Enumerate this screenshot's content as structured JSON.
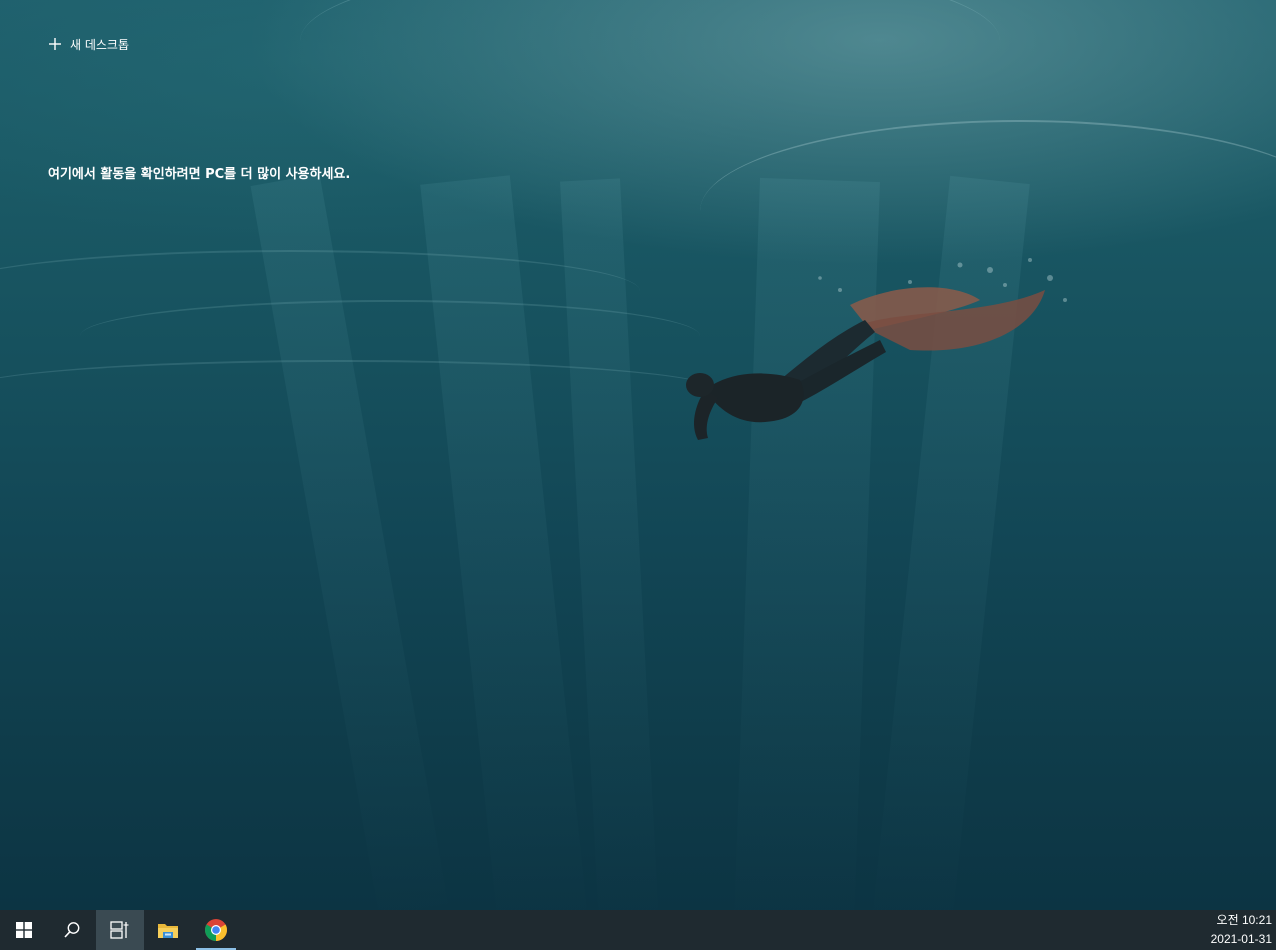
{
  "task_view": {
    "new_desktop_label": "새 데스크톱",
    "timeline_hint": "여기에서 활동을 확인하려면 PC를 더 많이 사용하세요."
  },
  "taskbar": {
    "buttons": [
      {
        "name": "start-button",
        "icon": "windows-logo-icon"
      },
      {
        "name": "search-button",
        "icon": "search-icon"
      },
      {
        "name": "task-view-button",
        "icon": "task-view-icon",
        "active": true
      },
      {
        "name": "file-explorer-button",
        "icon": "folder-icon"
      },
      {
        "name": "chrome-button",
        "icon": "chrome-icon",
        "running": true
      }
    ],
    "clock": {
      "time": "오전 10:21",
      "date": "2021-01-31"
    }
  },
  "colors": {
    "taskbar_bg": "#1f2a30",
    "active_button_bg": "#3a4a52",
    "running_indicator": "#8cc0e6"
  }
}
